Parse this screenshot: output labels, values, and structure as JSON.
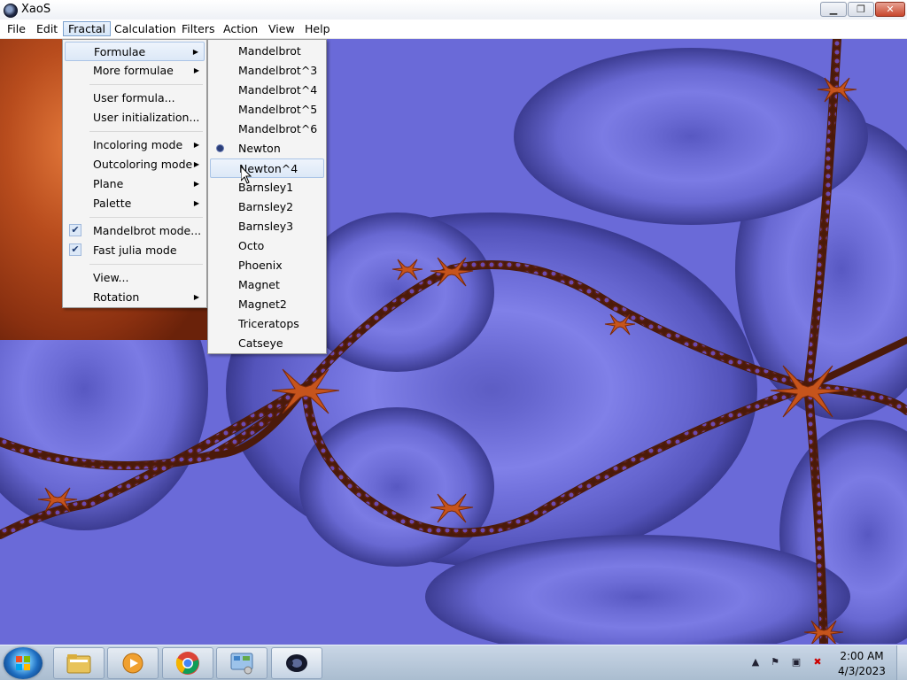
{
  "window": {
    "title": "XaoS"
  },
  "window_controls": {
    "minimize": "▁",
    "maximize": "❐",
    "close": "✕"
  },
  "menubar": [
    "File",
    "Edit",
    "Fractal",
    "Calculation",
    "Filters",
    "Action",
    "View",
    "Help"
  ],
  "fractal_menu": {
    "items": [
      {
        "label": "Formulae",
        "submenu": true
      },
      {
        "label": "More formulae",
        "submenu": true
      },
      {
        "label": "User formula..."
      },
      {
        "label": "User initialization..."
      },
      {
        "label": "Incoloring mode",
        "submenu": true
      },
      {
        "label": "Outcoloring mode",
        "submenu": true
      },
      {
        "label": "Plane",
        "submenu": true
      },
      {
        "label": "Palette",
        "submenu": true
      },
      {
        "label": "Mandelbrot mode...",
        "checked": true
      },
      {
        "label": "Fast julia mode",
        "checked": true
      },
      {
        "label": "View..."
      },
      {
        "label": "Rotation",
        "submenu": true
      }
    ]
  },
  "formulae_submenu": {
    "items": [
      "Mandelbrot",
      "Mandelbrot^3",
      "Mandelbrot^4",
      "Mandelbrot^5",
      "Mandelbrot^6",
      "Newton",
      "Newton^4",
      "Barnsley1",
      "Barnsley2",
      "Barnsley3",
      "Octo",
      "Phoenix",
      "Magnet",
      "Magnet2",
      "Triceratops",
      "Catseye"
    ],
    "selected": "Newton",
    "hovered": "Newton^4"
  },
  "taskbar": {
    "apps": [
      "explorer-icon",
      "media-player-icon",
      "chrome-icon",
      "control-panel-icon",
      "xaos-icon"
    ],
    "clock_time": "2:00 AM",
    "clock_date": "4/3/2023"
  },
  "colors": {
    "fractal_background": "#7e7ee6",
    "fractal_ridges": "#c04a14",
    "menu_highlight": "#dce8f7"
  }
}
